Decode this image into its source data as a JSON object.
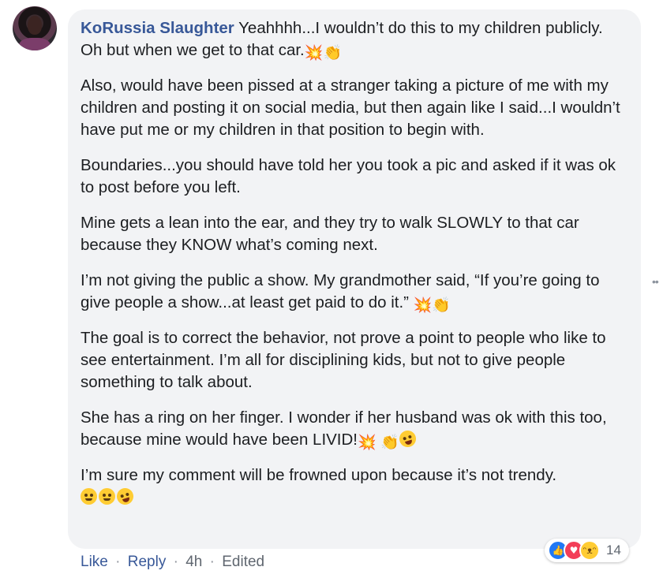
{
  "comment": {
    "author": "KoRussia Slaughter",
    "paragraphs": [
      "Yeahhhh...I wouldn’t do this to my children publicly. Oh but when we get to that car.",
      "Also, would have been pissed at a stranger taking a picture of me with my children and posting it on social media, but then again like I said...I wouldn’t have put me or my children in that position to begin with.",
      "Boundaries...you should have told her you took a pic and asked if it was ok to post before you left.",
      "Mine gets a lean into the ear, and they try to walk SLOWLY to that car because they KNOW what’s coming next.",
      "I’m not giving the public a show. My grandmother said, “If you’re going to give people a show...at least get paid to do it.”",
      "The goal is to correct the behavior, not prove a point to people who like to see entertainment. I’m all for disciplining kids, but not to give people something to talk about.",
      "She has a ring on her finger. I wonder if her husband was ok with this too, because mine would have been LIVID!",
      "I’m sure my comment will be frowned upon because it’s not trendy."
    ],
    "emoji": {
      "boom": "💥",
      "clap": "👏"
    }
  },
  "reactions": {
    "types": [
      "like",
      "love",
      "haha"
    ],
    "count": "14"
  },
  "actions": {
    "like": "Like",
    "reply": "Reply",
    "time": "4h",
    "edited": "Edited",
    "separator": "·"
  },
  "side_handle": "••"
}
